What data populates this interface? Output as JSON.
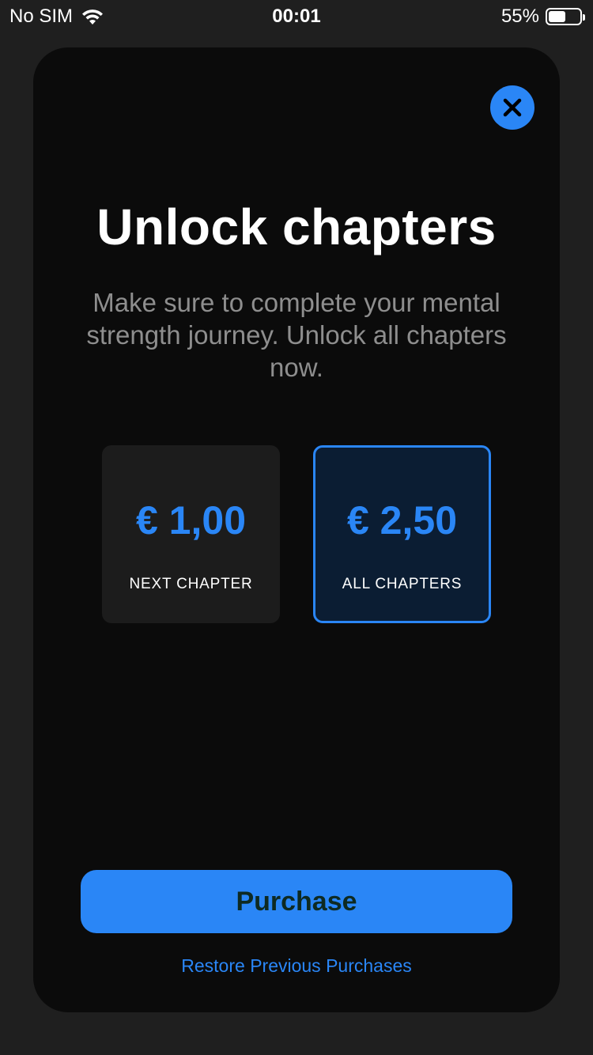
{
  "status_bar": {
    "carrier": "No SIM",
    "time": "00:01",
    "battery_percent": "55%",
    "battery_level": 0.55,
    "icons": [
      "wifi-icon",
      "battery-icon"
    ]
  },
  "modal": {
    "close_icon": "close-icon",
    "title": "Unlock chapters",
    "subtitle": "Make sure to complete your mental strength journey. Unlock all chapters now.",
    "options": [
      {
        "price": "€ 1,00",
        "label": "NEXT CHAPTER",
        "selected": false
      },
      {
        "price": "€ 2,50",
        "label": "ALL CHAPTERS",
        "selected": true
      }
    ],
    "purchase_label": "Purchase",
    "restore_label": "Restore Previous Purchases"
  },
  "colors": {
    "accent": "#2a86f6",
    "card_background": "#0b0b0b",
    "screen_background": "#1f1f1f",
    "selected_option_background": "#0b1d33",
    "unselected_option_background": "#1c1c1c",
    "subtitle_text": "#8e8e8e"
  }
}
